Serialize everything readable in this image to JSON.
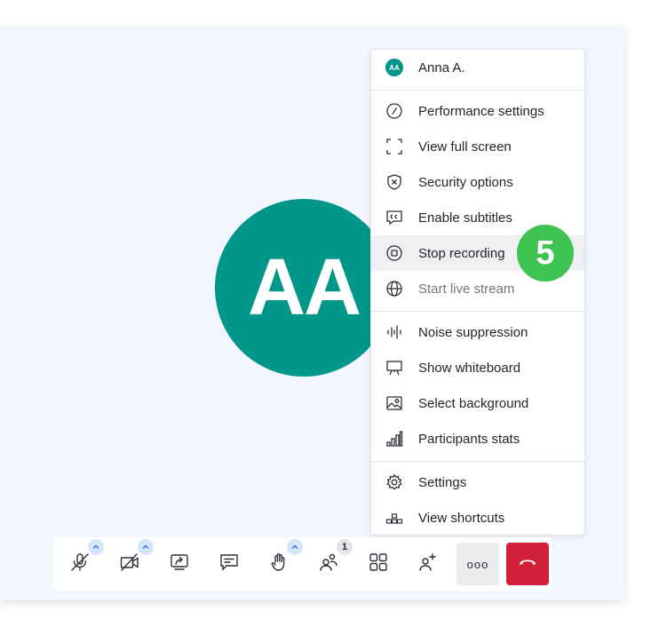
{
  "participant": {
    "initials": "AA",
    "color": "#00968a"
  },
  "menu": {
    "user": {
      "initials": "AA",
      "name": "Anna A."
    },
    "items": [
      {
        "label": "Performance settings",
        "icon": "gauge-icon"
      },
      {
        "label": "View full screen",
        "icon": "fullscreen-icon"
      },
      {
        "label": "Security options",
        "icon": "shield-icon"
      },
      {
        "label": "Enable subtitles",
        "icon": "cc-icon"
      },
      {
        "label": "Stop recording",
        "icon": "stop-record-icon",
        "highlighted": true
      },
      {
        "label": "Start live stream",
        "icon": "globe-icon",
        "disabled": true
      },
      {
        "label": "Noise suppression",
        "icon": "waveform-icon"
      },
      {
        "label": "Show whiteboard",
        "icon": "whiteboard-icon"
      },
      {
        "label": "Select background",
        "icon": "image-icon"
      },
      {
        "label": "Participants stats",
        "icon": "bar-chart-icon"
      },
      {
        "label": "Settings",
        "icon": "gear-icon"
      },
      {
        "label": "View shortcuts",
        "icon": "shortcuts-icon"
      }
    ]
  },
  "step_badge": {
    "number": "5",
    "color": "#3fc451"
  },
  "toolbar": {
    "participants_count": "1",
    "more_label": "ooo",
    "buttons": [
      "microphone-muted-icon",
      "camera-off-icon",
      "share-screen-icon",
      "chat-icon",
      "raise-hand-icon",
      "participants-icon",
      "tile-view-icon",
      "invite-icon",
      "more-icon",
      "hangup-icon"
    ]
  },
  "colors": {
    "accent": "#00968a",
    "hangup": "#d1213a",
    "step": "#3fc451",
    "caret": "#d5e6fb"
  }
}
